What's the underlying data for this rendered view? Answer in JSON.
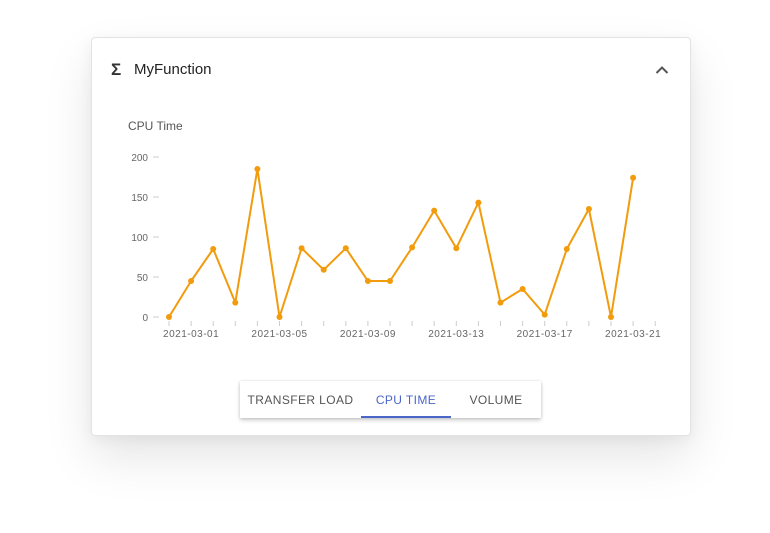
{
  "card": {
    "icon": "sigma-icon",
    "icon_glyph": "Σ",
    "title": "MyFunction",
    "collapse_icon": "chevron-up-icon"
  },
  "tabs": [
    {
      "label": "TRANSFER LOAD",
      "active": false
    },
    {
      "label": "CPU TIME",
      "active": true
    },
    {
      "label": "VOLUME",
      "active": false
    }
  ],
  "colors": {
    "series": "#f29b0c",
    "active_tab": "#4a66c8"
  },
  "chart_data": {
    "type": "line",
    "title": "CPU Time",
    "xlabel": "",
    "ylabel": "",
    "ylim": [
      0,
      200
    ],
    "y_ticks": [
      0,
      50,
      100,
      150,
      200
    ],
    "x_tick_labels": [
      "2021-03-01",
      "2021-03-05",
      "2021-03-09",
      "2021-03-13",
      "2021-03-17",
      "2021-03-21"
    ],
    "x": [
      "2021-02-28",
      "2021-03-01",
      "2021-03-02",
      "2021-03-03",
      "2021-03-04",
      "2021-03-05",
      "2021-03-06",
      "2021-03-07",
      "2021-03-08",
      "2021-03-09",
      "2021-03-10",
      "2021-03-11",
      "2021-03-12",
      "2021-03-13",
      "2021-03-14",
      "2021-03-15",
      "2021-03-16",
      "2021-03-17",
      "2021-03-18",
      "2021-03-19",
      "2021-03-20",
      "2021-03-21",
      "2021-03-22"
    ],
    "series": [
      {
        "values": [
          0,
          45,
          85,
          18,
          185,
          0,
          86,
          59,
          86,
          45,
          45,
          87,
          133,
          86,
          143,
          18,
          35,
          3,
          85,
          135,
          0,
          174
        ]
      }
    ],
    "grid": false
  }
}
